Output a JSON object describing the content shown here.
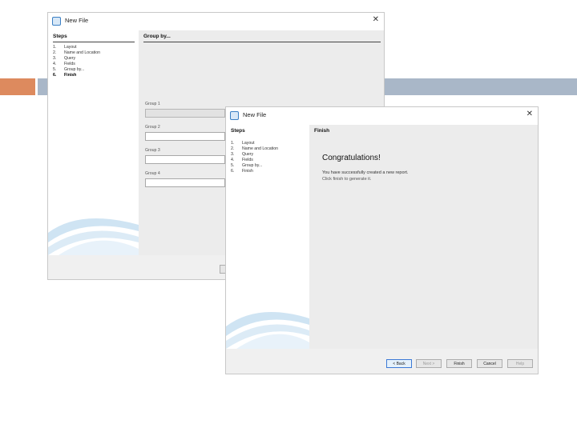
{
  "colors": {
    "accent_left": "#dd8a5e",
    "accent_right": "#a9b7c8",
    "dialog_bg": "#f0f0f0"
  },
  "back_dialog": {
    "title": "New File",
    "close_icon": "close-icon",
    "steps_heading": "Steps",
    "steps": [
      {
        "num": "1.",
        "label": "Layout"
      },
      {
        "num": "2.",
        "label": "Name and Location"
      },
      {
        "num": "3.",
        "label": "Query"
      },
      {
        "num": "4.",
        "label": "Fields"
      },
      {
        "num": "5.",
        "label": "Group by..."
      },
      {
        "num": "6.",
        "label": "Finish"
      }
    ],
    "current_step": 6,
    "content_title": "Group by...",
    "groups": [
      {
        "label": "Group 1"
      },
      {
        "label": "Group 2"
      },
      {
        "label": "Group 3"
      },
      {
        "label": "Group 4"
      }
    ]
  },
  "front_dialog": {
    "title": "New File",
    "close_icon": "close-icon",
    "steps_heading": "Steps",
    "steps": [
      {
        "num": "1.",
        "label": "Layout"
      },
      {
        "num": "2.",
        "label": "Name and Location"
      },
      {
        "num": "3.",
        "label": "Query"
      },
      {
        "num": "4.",
        "label": "Fields"
      },
      {
        "num": "5.",
        "label": "Group by..."
      },
      {
        "num": "6.",
        "label": "Finish"
      }
    ],
    "content_title": "Finish",
    "congrats": "Congratulations!",
    "message_line1": "You have successfully created a new report.",
    "message_line2": "Click finish to generate it.",
    "buttons": {
      "back": "< Back",
      "next": "Next >",
      "finish": "Finish",
      "cancel": "Cancel",
      "help": "Help"
    }
  }
}
